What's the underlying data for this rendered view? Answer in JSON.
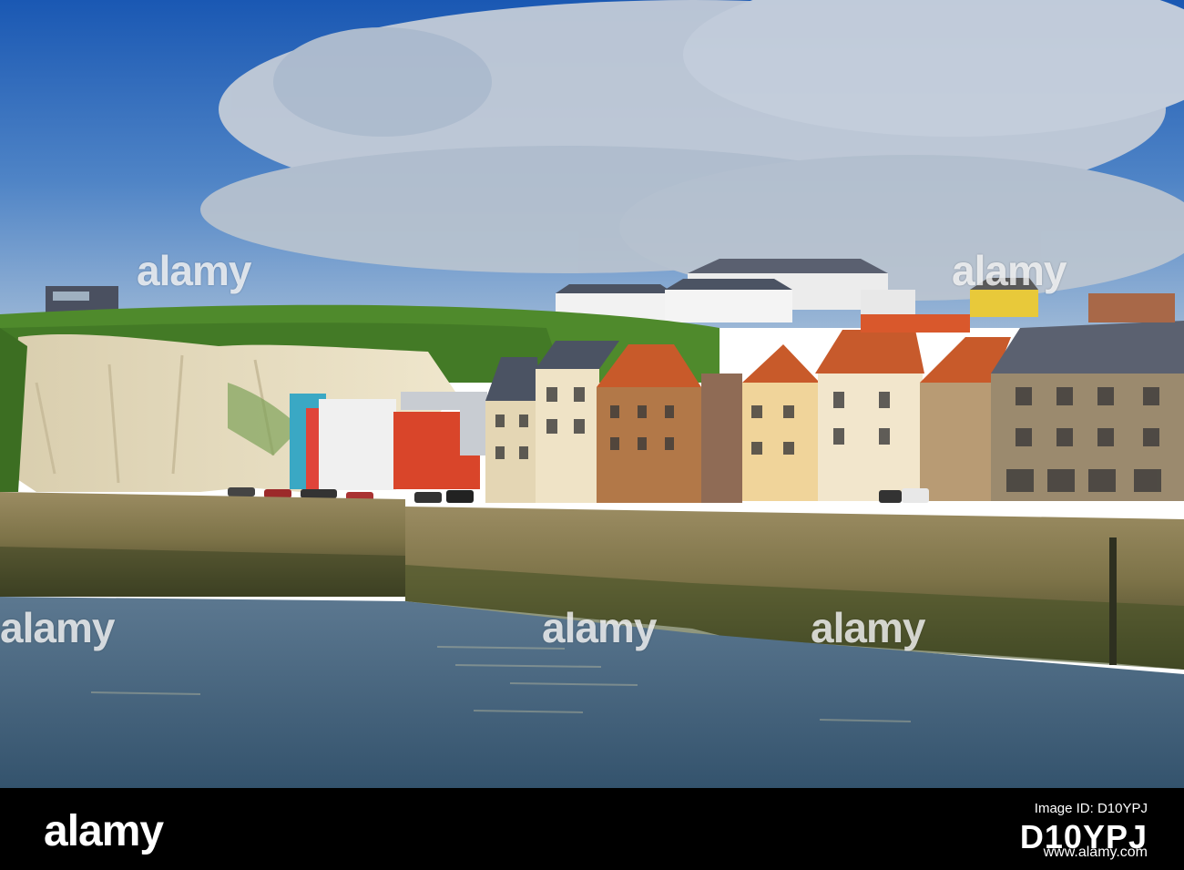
{
  "photo": {
    "subject": "Harbour waterfront with colourful townhouses below white chalk cliffs",
    "palette": {
      "sky_top": "#1f5fb8",
      "sky_bottom": "#8fb0d4",
      "cloud": "#c9d0da",
      "cliff": "#e6dcc2",
      "grass": "#4f8a2c",
      "water": "#3f5f7a",
      "quay_stone": "#8a7e5a",
      "roof_orange": "#c85a2a",
      "roof_slate": "#4b5363",
      "facade_red": "#d9452a",
      "facade_teal": "#3aa8c4",
      "facade_cream": "#eadbb7",
      "facade_brick": "#b27848"
    }
  },
  "watermark": {
    "text": "alamy"
  },
  "footer": {
    "logo_text": "alamy",
    "image_id_caption": "Image ID: D10YPJ",
    "image_id": "D10YPJ",
    "url": "www.alamy.com"
  }
}
